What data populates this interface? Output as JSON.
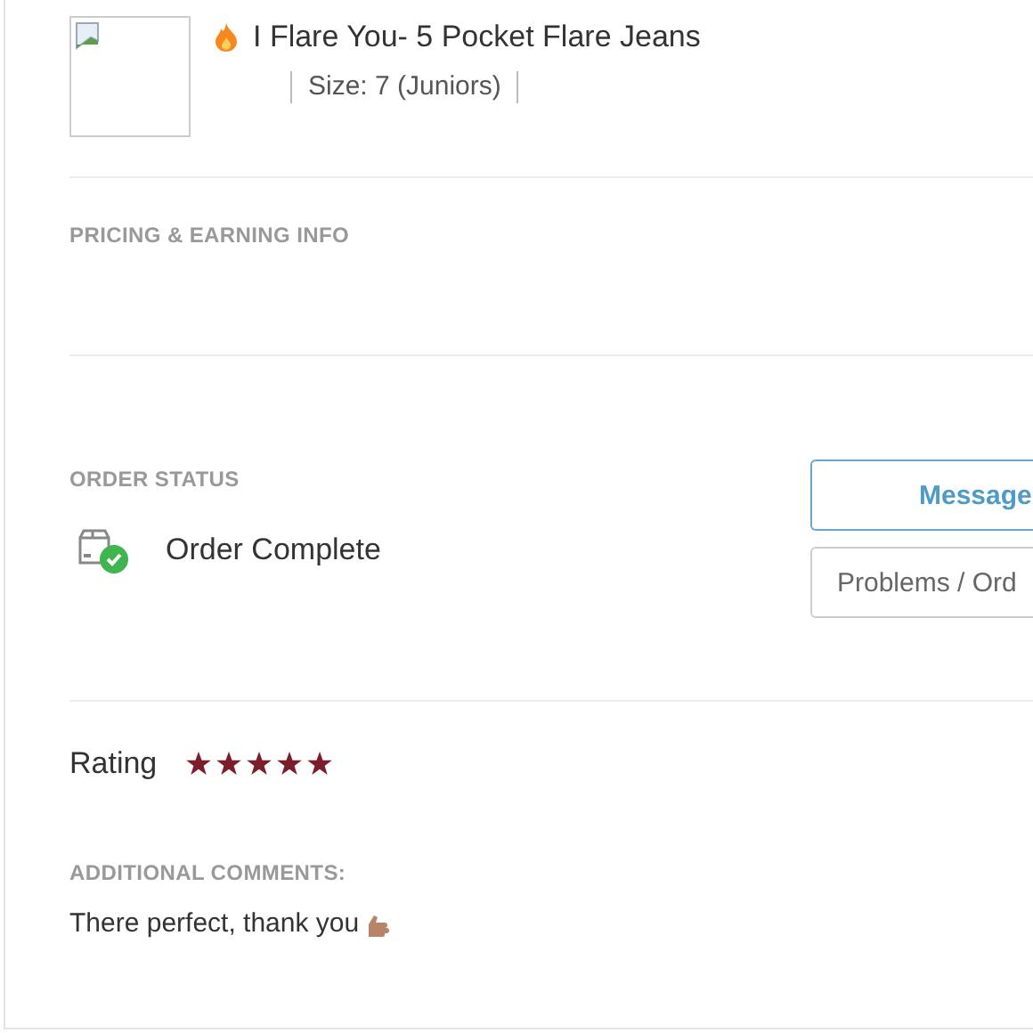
{
  "product": {
    "title": "I Flare You- 5 Pocket Flare Jeans",
    "size": "Size: 7 (Juniors)"
  },
  "pricing": {
    "heading": "PRICING & EARNING INFO"
  },
  "order_status": {
    "heading": "ORDER STATUS",
    "status": "Order Complete"
  },
  "buttons": [
    "Message",
    "Problems / Ord"
  ],
  "rating": {
    "label": "Rating",
    "stars": 5
  },
  "comments": {
    "heading": "ADDITIONAL COMMENTS:",
    "text": "There perfect, thank you"
  }
}
